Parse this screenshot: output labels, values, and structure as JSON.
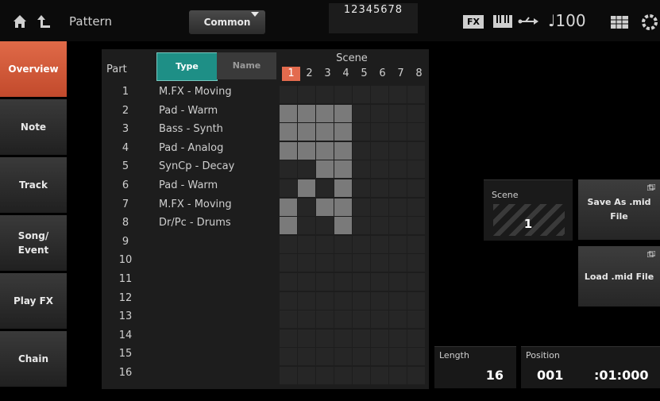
{
  "header": {
    "title": "Pattern",
    "common_label": "Common",
    "part_numbers_top": "12345678",
    "fx_label": "FX",
    "tempo": "♩100",
    "icons": [
      "home-icon",
      "back-arrow-icon",
      "keyboard-icon",
      "usb-icon",
      "grid-icon",
      "gear-icon"
    ]
  },
  "sidebar": {
    "tabs": [
      {
        "label": "Overview",
        "active": true
      },
      {
        "label": "Note"
      },
      {
        "label": "Track"
      },
      {
        "label": "Song/\nEvent"
      },
      {
        "label": "Play FX"
      },
      {
        "label": "Chain"
      }
    ]
  },
  "table": {
    "part_header": "Part",
    "type_label": "Type",
    "name_label": "Name",
    "scene_header": "Scene",
    "scenes": [
      "1",
      "2",
      "3",
      "4",
      "5",
      "6",
      "7",
      "8"
    ],
    "active_scene": "1",
    "rows": [
      {
        "part": "1",
        "name": "M.FX - Moving",
        "cells": [
          0,
          0,
          0,
          0,
          0,
          0,
          0,
          0
        ]
      },
      {
        "part": "2",
        "name": "Pad - Warm",
        "cells": [
          1,
          1,
          1,
          1,
          0,
          0,
          0,
          0
        ]
      },
      {
        "part": "3",
        "name": "Bass - Synth",
        "cells": [
          1,
          1,
          1,
          1,
          0,
          0,
          0,
          0
        ]
      },
      {
        "part": "4",
        "name": "Pad - Analog",
        "cells": [
          1,
          1,
          1,
          1,
          0,
          0,
          0,
          0
        ]
      },
      {
        "part": "5",
        "name": "SynCp - Decay",
        "cells": [
          0,
          0,
          1,
          1,
          0,
          0,
          0,
          0
        ]
      },
      {
        "part": "6",
        "name": "Pad - Warm",
        "cells": [
          0,
          1,
          0,
          1,
          0,
          0,
          0,
          0
        ]
      },
      {
        "part": "7",
        "name": "M.FX - Moving",
        "cells": [
          1,
          0,
          1,
          1,
          0,
          0,
          0,
          0
        ]
      },
      {
        "part": "8",
        "name": "Dr/Pc - Drums",
        "cells": [
          1,
          0,
          0,
          1,
          0,
          0,
          0,
          0
        ]
      },
      {
        "part": "9",
        "name": "",
        "cells": [
          0,
          0,
          0,
          0,
          0,
          0,
          0,
          0
        ]
      },
      {
        "part": "10",
        "name": "",
        "cells": [
          0,
          0,
          0,
          0,
          0,
          0,
          0,
          0
        ]
      },
      {
        "part": "11",
        "name": "",
        "cells": [
          0,
          0,
          0,
          0,
          0,
          0,
          0,
          0
        ]
      },
      {
        "part": "12",
        "name": "",
        "cells": [
          0,
          0,
          0,
          0,
          0,
          0,
          0,
          0
        ]
      },
      {
        "part": "13",
        "name": "",
        "cells": [
          0,
          0,
          0,
          0,
          0,
          0,
          0,
          0
        ]
      },
      {
        "part": "14",
        "name": "",
        "cells": [
          0,
          0,
          0,
          0,
          0,
          0,
          0,
          0
        ]
      },
      {
        "part": "15",
        "name": "",
        "cells": [
          0,
          0,
          0,
          0,
          0,
          0,
          0,
          0
        ]
      },
      {
        "part": "16",
        "name": "",
        "cells": [
          0,
          0,
          0,
          0,
          0,
          0,
          0,
          0
        ]
      }
    ]
  },
  "right_panel": {
    "scene_label": "Scene",
    "scene_value": "1",
    "save_label": "Save As .mid\nFile",
    "load_label": "Load .mid File",
    "length_label": "Length",
    "length_value": "16",
    "position_label": "Position",
    "position_measure": "001",
    "position_time": ":01:000"
  }
}
